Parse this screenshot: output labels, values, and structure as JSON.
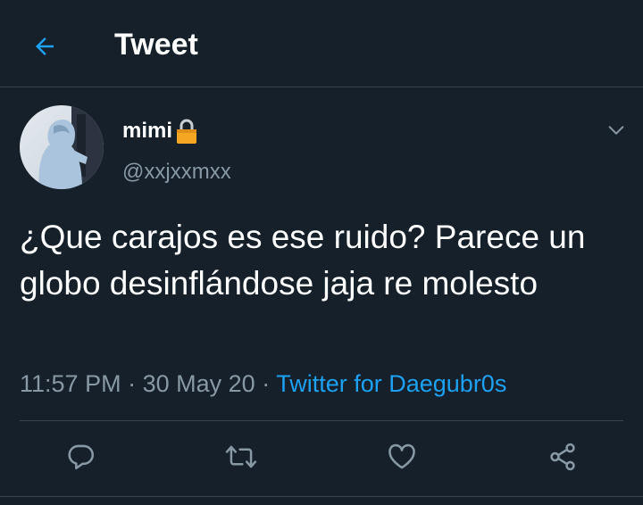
{
  "header": {
    "title": "Tweet",
    "back_icon": "arrow-left-icon"
  },
  "author": {
    "display_name": "mimi",
    "protected_icon": "lock-icon",
    "handle": "@xxjxxmxx",
    "avatar": "avatar-photo"
  },
  "tweet": {
    "text": "¿Que carajos es ese ruido? Parece un globo desinflándose jaja re molesto",
    "time": "11:57 PM",
    "separator_1": "·",
    "date": "30 May 20",
    "separator_2": "·",
    "source": "Twitter for Daegubr0s"
  },
  "actions": [
    {
      "name": "reply",
      "icon": "reply-icon"
    },
    {
      "name": "retweet",
      "icon": "retweet-icon"
    },
    {
      "name": "like",
      "icon": "heart-icon"
    },
    {
      "name": "share",
      "icon": "share-icon"
    }
  ],
  "colors": {
    "background": "#15202b",
    "accent": "#1da1f2",
    "secondary_text": "#8899a6",
    "border": "#38444d",
    "lock": "#f5a623"
  }
}
